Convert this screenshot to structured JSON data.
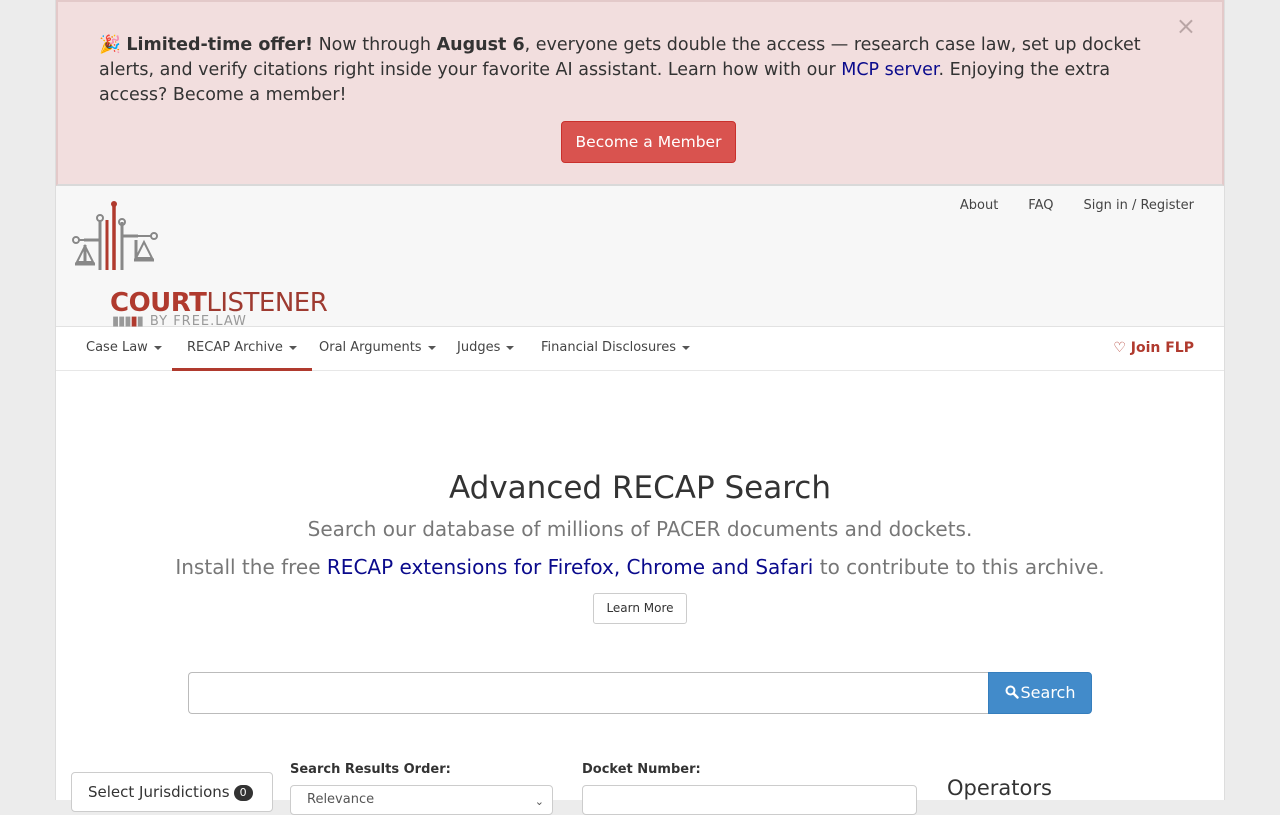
{
  "alert": {
    "emoji": "🎉",
    "bold_lead": "Limited-time offer!",
    "text_1": " Now through ",
    "bold_date": "August 6",
    "text_2": ", everyone gets double the access — research case law, set up docket alerts, and verify citations right inside your favorite AI assistant. Learn how with our ",
    "link": "MCP server",
    "text_3": ". Enjoying the extra access? Become a member!",
    "close": "×",
    "button": "Become a Member"
  },
  "header": {
    "logo_title_1": "COURT",
    "logo_title_2": "LISTENER",
    "logo_sub": "BY FREE.LAW",
    "top_links": [
      "About",
      "FAQ",
      "Sign in / Register"
    ]
  },
  "nav": {
    "items": [
      "Case Law",
      "RECAP Archive",
      "Oral Arguments",
      "Judges",
      "Financial Disclosures"
    ],
    "active": "RECAP Archive",
    "join": "Join FLP"
  },
  "main": {
    "title": "Advanced RECAP Search",
    "subtitle": "Search our database of millions of PACER documents and dockets.",
    "install_pre": "Install the free ",
    "install_link": "RECAP extensions for Firefox, Chrome and Safari",
    "install_post": " to contribute to this archive.",
    "learn_more": "Learn More",
    "search_value": "",
    "search_button": "Search",
    "jurisdictions_label": "Select Jurisdictions",
    "jurisdictions_count": "0",
    "order_label": "Search Results Order:",
    "order_value": "Relevance",
    "docket_label": "Docket Number:",
    "docket_value": "",
    "operators_heading": "Operators"
  },
  "colors": {
    "brand_red": "#b03a2e",
    "alert_bg": "#f2dede",
    "danger": "#d9534f",
    "primary": "#428bca",
    "link": "#0a0a8c"
  }
}
